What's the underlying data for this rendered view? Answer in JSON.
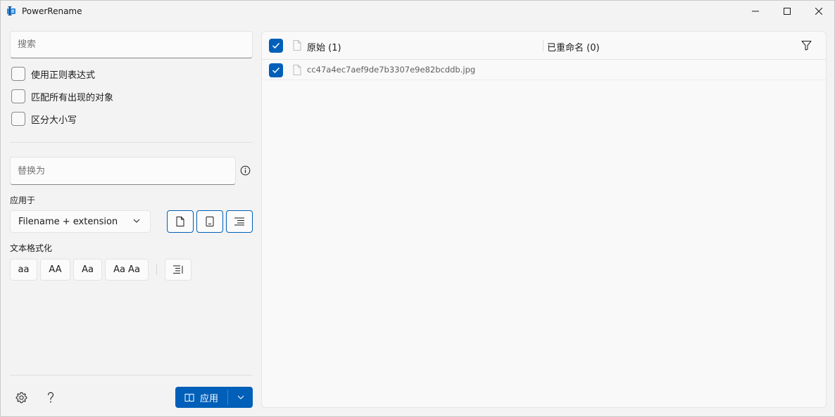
{
  "window": {
    "title": "PowerRename"
  },
  "search": {
    "placeholder": "搜索"
  },
  "options": [
    {
      "label": "使用正则表达式",
      "checked": false
    },
    {
      "label": "匹配所有出现的对象",
      "checked": false
    },
    {
      "label": "区分大小写",
      "checked": false
    }
  ],
  "replace": {
    "placeholder": "替换为",
    "info_icon": "info-icon"
  },
  "apply_to": {
    "label": "应用于",
    "selected": "Filename + extension"
  },
  "text_format": {
    "label": "文本格式化",
    "buttons": [
      "aa",
      "AA",
      "Aa",
      "Aa Aa"
    ]
  },
  "apply_button": {
    "label": "应用"
  },
  "list": {
    "original_header": "原始 (1)",
    "renamed_header": "已重命名 (0)",
    "rows": [
      {
        "original": "cc47a4ec7aef9de7b3307e9e82bcddb.jpg",
        "renamed": "",
        "checked": true
      }
    ]
  },
  "colors": {
    "accent": "#005fb8",
    "background": "#f3f3f3",
    "pane": "#f9f9f9"
  }
}
